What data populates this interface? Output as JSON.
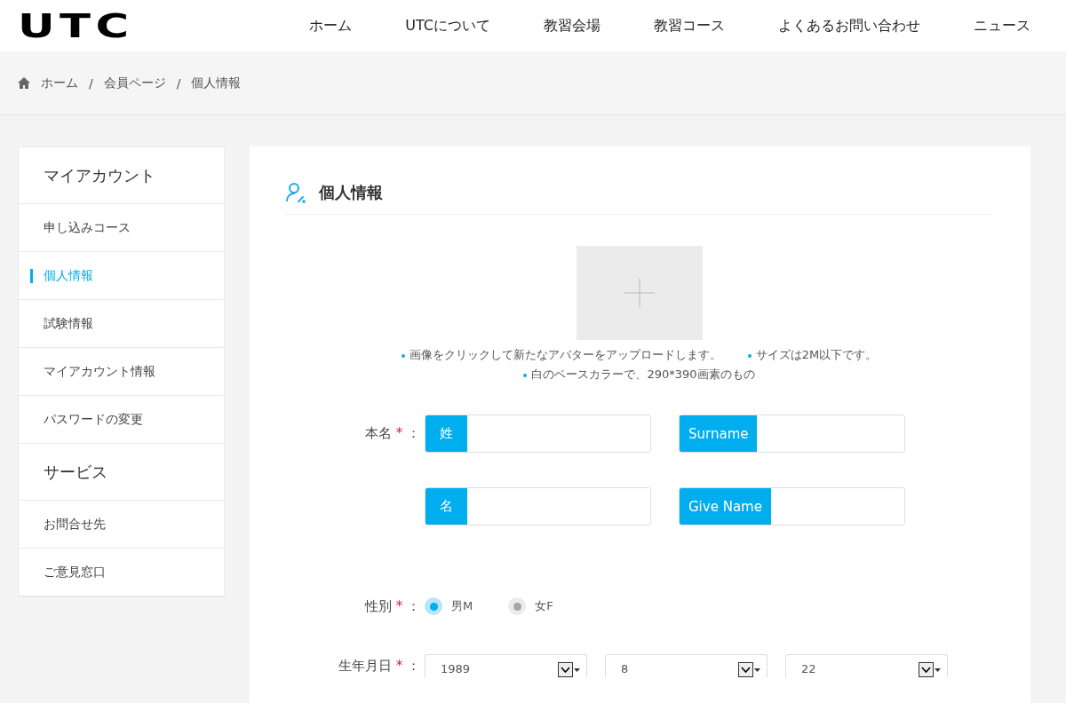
{
  "header": {
    "logo": "UTC",
    "nav": [
      "ホーム",
      "UTCについて",
      "教習会場",
      "教習コース",
      "よくあるお問い合わせ",
      "ニュース"
    ]
  },
  "breadcrumb": [
    "ホーム",
    "/",
    "会員ページ",
    "/",
    "個人情報"
  ],
  "sidebar": {
    "groups": [
      {
        "title": "マイアカウント",
        "items": [
          {
            "label": "申し込みコース",
            "selected": false
          },
          {
            "label": "個人情報",
            "selected": true
          },
          {
            "label": "試験情報",
            "selected": false
          },
          {
            "label": "マイアカウント情報",
            "selected": false
          },
          {
            "label": "パスワードの変更",
            "selected": false
          }
        ]
      },
      {
        "title": "サービス",
        "items": [
          {
            "label": "お問合せ先",
            "selected": false
          },
          {
            "label": "ご意見窓口",
            "selected": false
          }
        ]
      }
    ]
  },
  "content": {
    "title": "個人情報",
    "avatar_notes": [
      [
        "画像をクリックして新たなアバターをアップロードします。",
        "サイズは2M以下です。"
      ],
      [
        "白のベースカラーで、290*390画素のもの"
      ]
    ],
    "name": {
      "label": "本名",
      "required": "*",
      "colon": "：",
      "rows": [
        [
          {
            "addon": "姓"
          },
          {
            "addon": "Surname"
          }
        ],
        [
          {
            "addon": "名"
          },
          {
            "addon": "Give Name"
          }
        ]
      ]
    },
    "gender": {
      "label": "性別",
      "required": "*",
      "colon": "：",
      "options": [
        {
          "label": "男M",
          "selected": true
        },
        {
          "label": "女F",
          "selected": false
        }
      ]
    },
    "birthday": {
      "label": "生年月日",
      "required": "*",
      "colon": "：",
      "selects": [
        {
          "value": "1989"
        },
        {
          "value": "8"
        },
        {
          "value": "22"
        }
      ]
    }
  }
}
